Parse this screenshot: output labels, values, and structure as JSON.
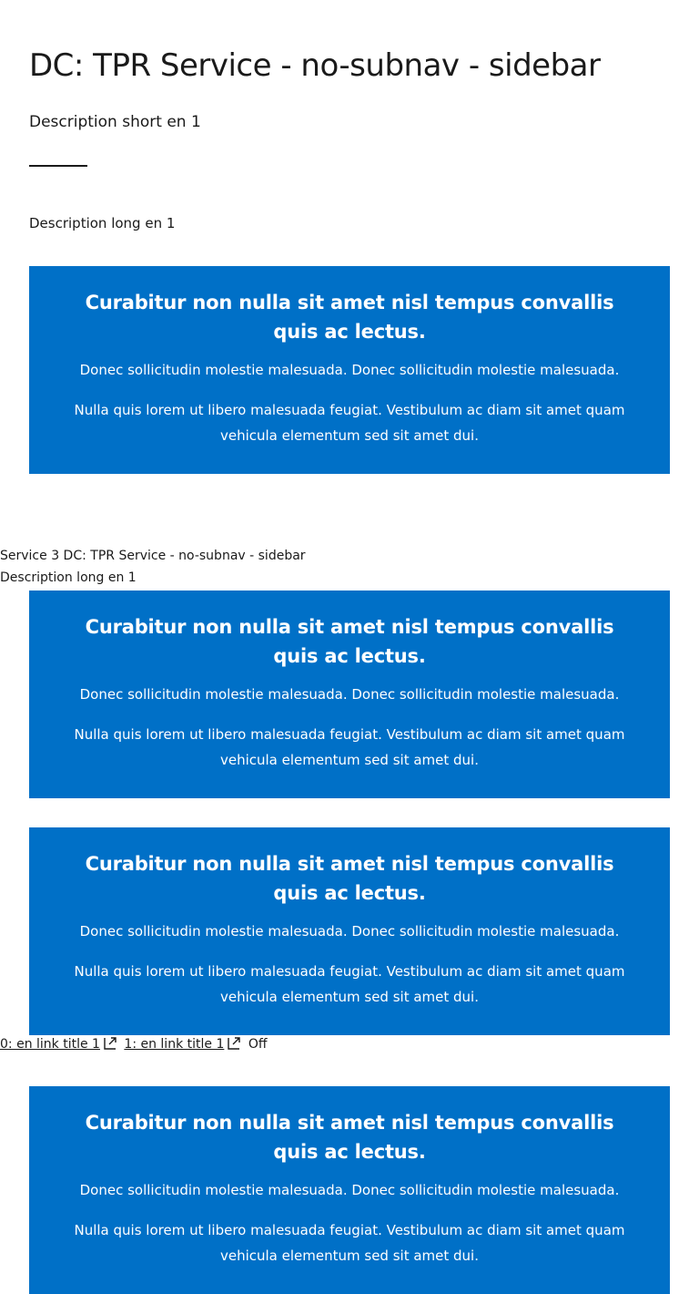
{
  "page": {
    "title": "DC: TPR Service - no-subnav - sidebar",
    "description_short": "Description short en 1",
    "description_long": "Description long en 1"
  },
  "callout": {
    "title": "Curabitur non nulla sit amet nisl tempus convallis quis ac lectus.",
    "para1": "Donec sollicitudin molestie malesuada. Donec sollicitudin molestie malesuada.",
    "para2": "Nulla quis lorem ut libero malesuada feugiat. Vestibulum ac diam sit amet quam vehicula elementum sed sit amet dui."
  },
  "service": {
    "heading": "Service 3 DC: TPR Service - no-subnav - sidebar",
    "description_long": "Description long en 1"
  },
  "links": [
    {
      "label": "0: en link title 1",
      "icon": "external-link-icon"
    },
    {
      "label": "1: en link title 1",
      "icon": "external-link-icon"
    }
  ],
  "toggle_state": "Off",
  "colors": {
    "callout_bg": "#0070c7",
    "text": "#1a1a1a"
  }
}
